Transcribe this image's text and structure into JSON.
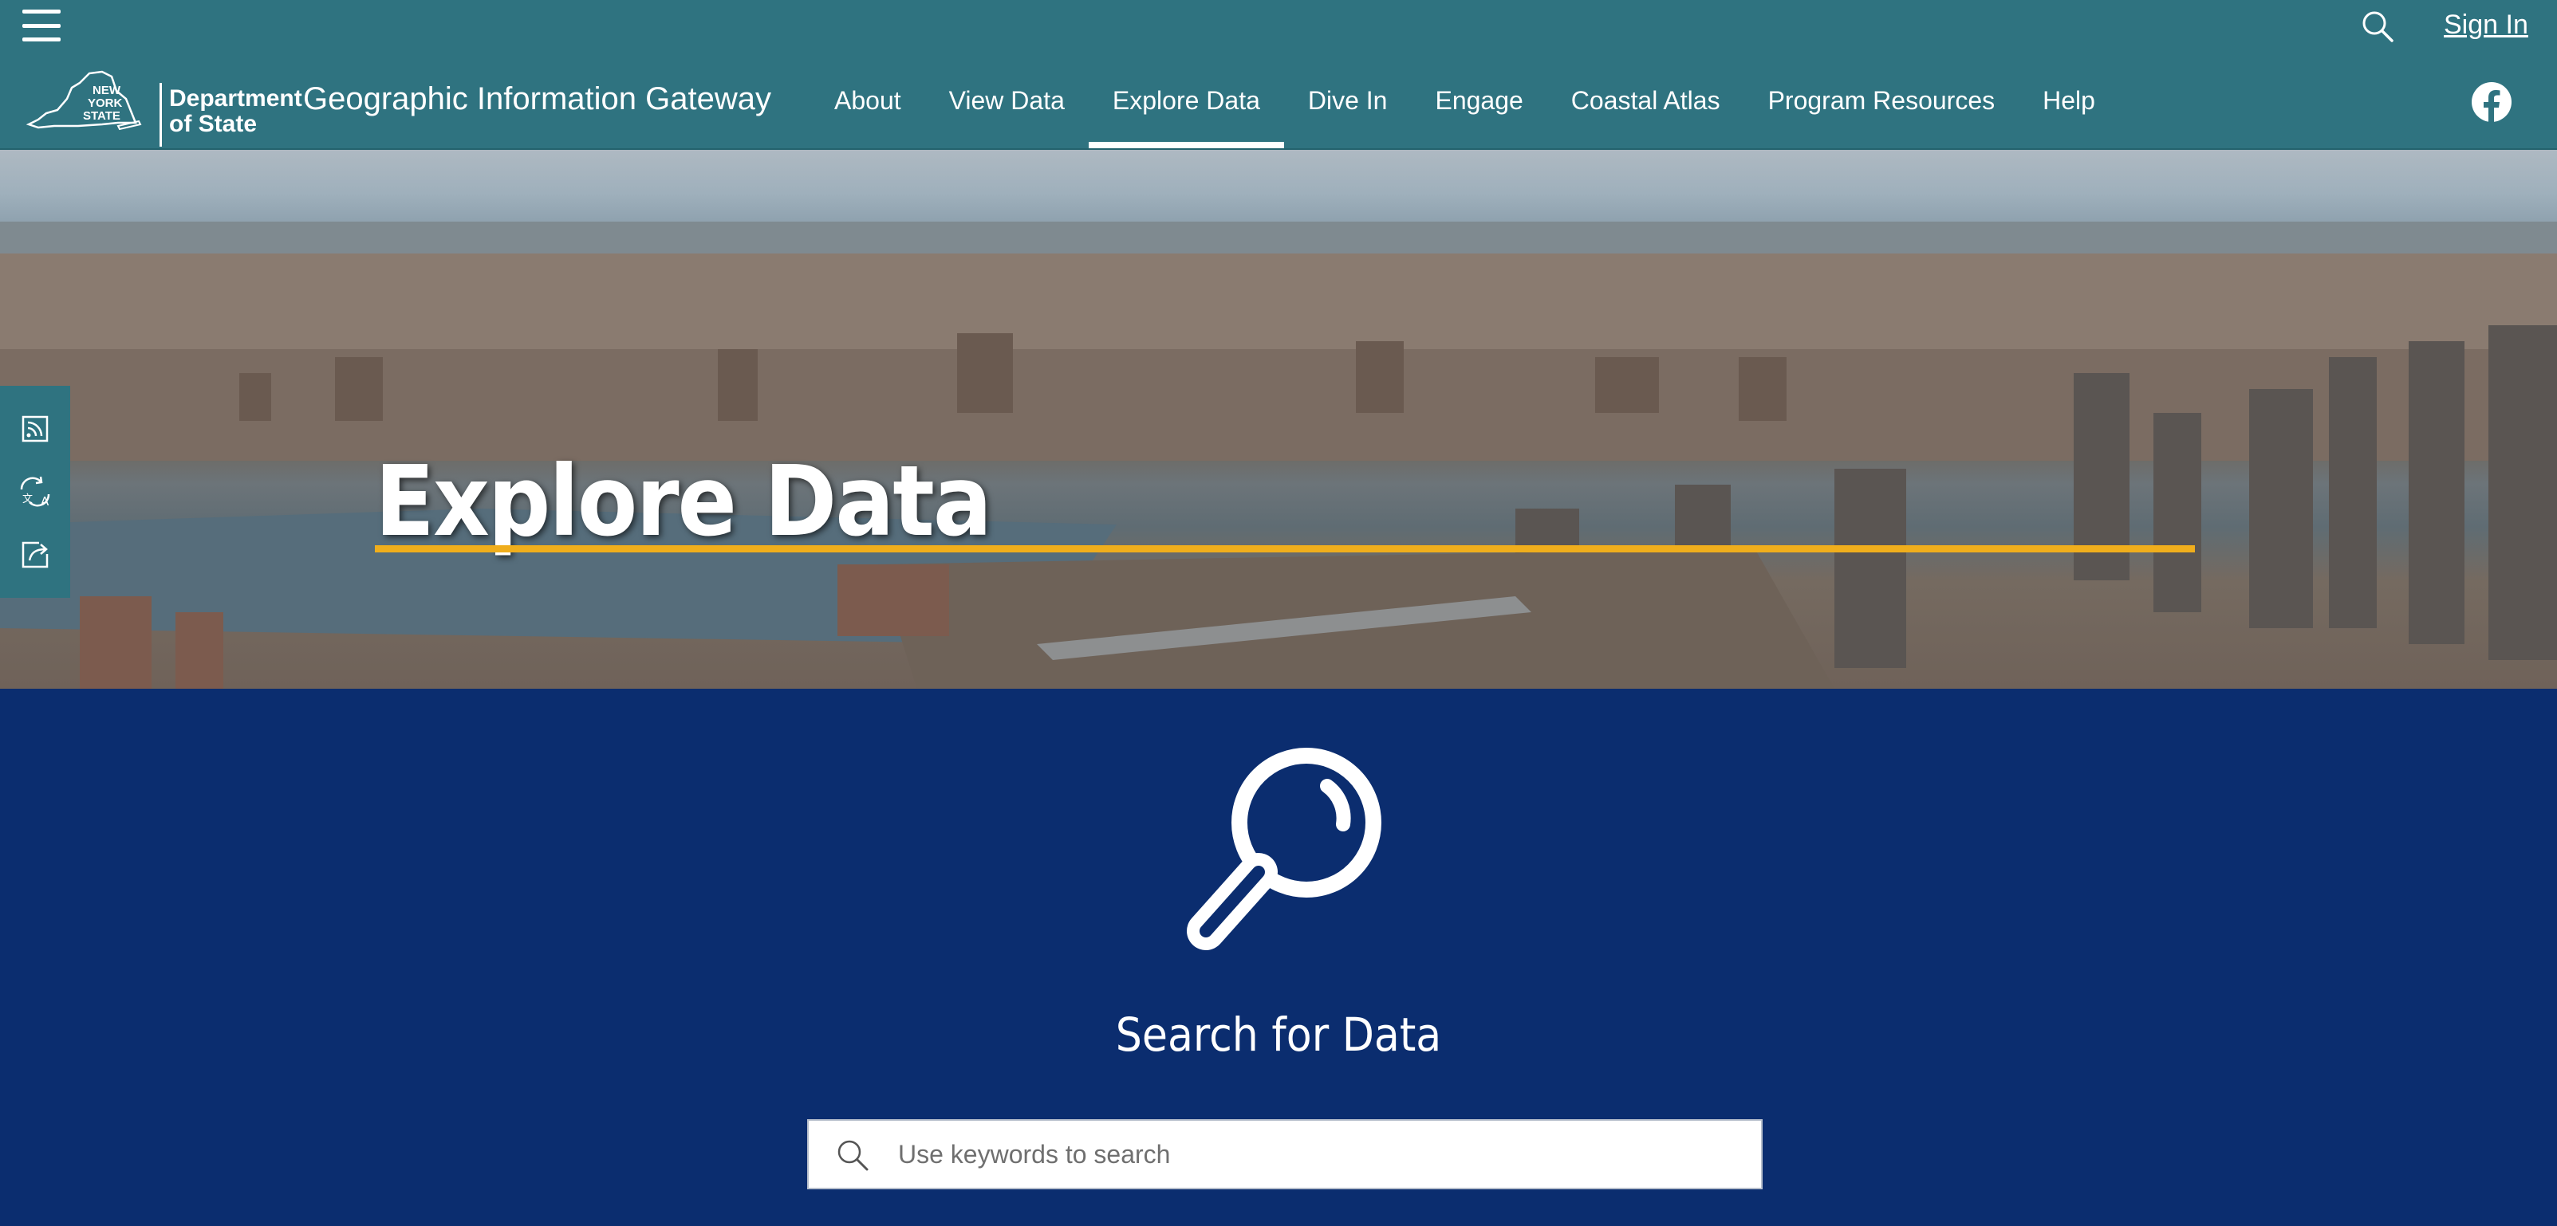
{
  "topbar": {
    "signin_label": "Sign In"
  },
  "header": {
    "logo_text_line1": "Department",
    "logo_text_line2": "of State",
    "logo_state_text": "NEW YORK STATE",
    "site_title": "Geographic Information Gateway"
  },
  "nav": {
    "items": [
      {
        "label": "About"
      },
      {
        "label": "View Data"
      },
      {
        "label": "Explore Data",
        "active": true
      },
      {
        "label": "Dive In"
      },
      {
        "label": "Engage"
      },
      {
        "label": "Coastal Atlas"
      },
      {
        "label": "Program Resources"
      },
      {
        "label": "Help"
      }
    ]
  },
  "hero": {
    "title": "Explore Data"
  },
  "search": {
    "heading": "Search for Data",
    "placeholder": "Use keywords to search"
  },
  "colors": {
    "header_teal": "#2f7380",
    "section_navy": "#0b2d6f",
    "accent_gold": "#f0ae1c"
  },
  "icons": {
    "menu": "hamburger-icon",
    "search": "search-icon",
    "facebook": "facebook-icon",
    "rss": "rss-icon",
    "translate": "translate-icon",
    "share": "share-icon"
  }
}
